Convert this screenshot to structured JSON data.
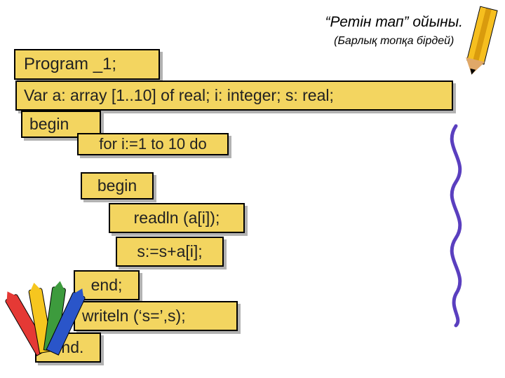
{
  "header": {
    "title": "“Ретін тап” ойыны.",
    "subtitle": "(Барлық топқа бірдей)"
  },
  "code": {
    "l1": "Program _1;",
    "l2": "Var a: array [1..10] of real; i: integer; s: real;",
    "l3": "begin",
    "l4": "for i:=1 to 10 do",
    "l5": "begin",
    "l6": "readln (a[i]);",
    "l7": "s:=s+a[i];",
    "l8": "end;",
    "l9": "writeln (‘s=’,s);",
    "l10": "end."
  }
}
